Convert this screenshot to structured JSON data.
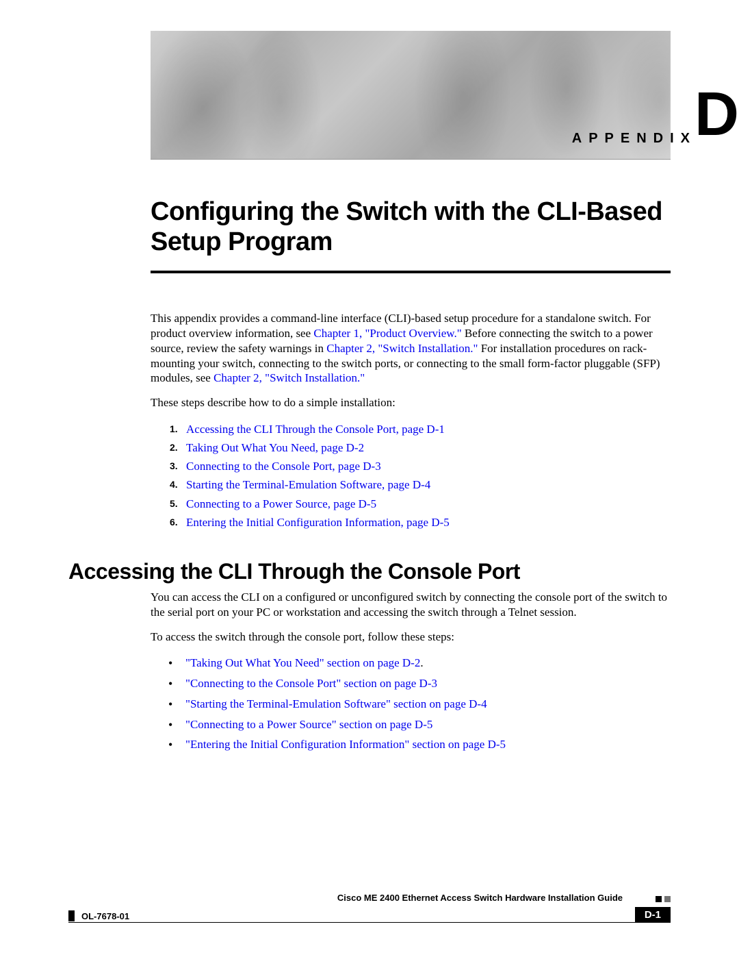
{
  "header": {
    "appendix_label": "APPENDIX",
    "appendix_letter": "D",
    "chapter_title": "Configuring the Switch with the CLI-Based Setup Program"
  },
  "intro": {
    "text1": "This appendix provides a command-line interface (CLI)-based setup procedure for a standalone switch. For product overview information, see ",
    "link1": "Chapter 1, \"Product Overview.\"",
    "text2": " Before connecting the switch to a power source, review the safety warnings in ",
    "link2": "Chapter 2, \"Switch Installation.\"",
    "text3": " For installation procedures on rack-mounting your switch, connecting to the switch ports, or connecting to the small form-factor pluggable (SFP) modules, see ",
    "link3": "Chapter 2, \"Switch Installation.\"",
    "steps_intro": "These steps describe how to do a simple installation:"
  },
  "steps": [
    "Accessing the CLI Through the Console Port, page D-1",
    "Taking Out What You Need, page D-2",
    "Connecting to the Console Port, page D-3",
    "Starting the Terminal-Emulation Software, page D-4",
    "Connecting to a Power Source, page D-5",
    "Entering the Initial Configuration Information, page D-5"
  ],
  "numbers": [
    "1.",
    "2.",
    "3.",
    "4.",
    "5.",
    "6."
  ],
  "section": {
    "heading": "Accessing the CLI Through the Console Port",
    "para": "You can access the CLI on a configured or unconfigured switch by connecting the console port of the switch to the serial port on your PC or workstation and accessing the switch through a Telnet session.",
    "follow": "To access the switch through the console port, follow these steps:"
  },
  "bullets": [
    {
      "text": "\"Taking Out What You Need\" section on page D-2",
      "suffix": "."
    },
    {
      "text": "\"Connecting to the Console Port\" section on page D-3",
      "suffix": ""
    },
    {
      "text": "\"Starting the Terminal-Emulation Software\" section on page D-4",
      "suffix": ""
    },
    {
      "text": "\"Connecting to a Power Source\" section on page D-5",
      "suffix": ""
    },
    {
      "text": "\"Entering the Initial Configuration Information\" section on page D-5",
      "suffix": ""
    }
  ],
  "footer": {
    "guide_title": "Cisco ME 2400 Ethernet Access Switch Hardware Installation Guide",
    "doc_id": "OL-7678-01",
    "page_num": "D-1"
  }
}
